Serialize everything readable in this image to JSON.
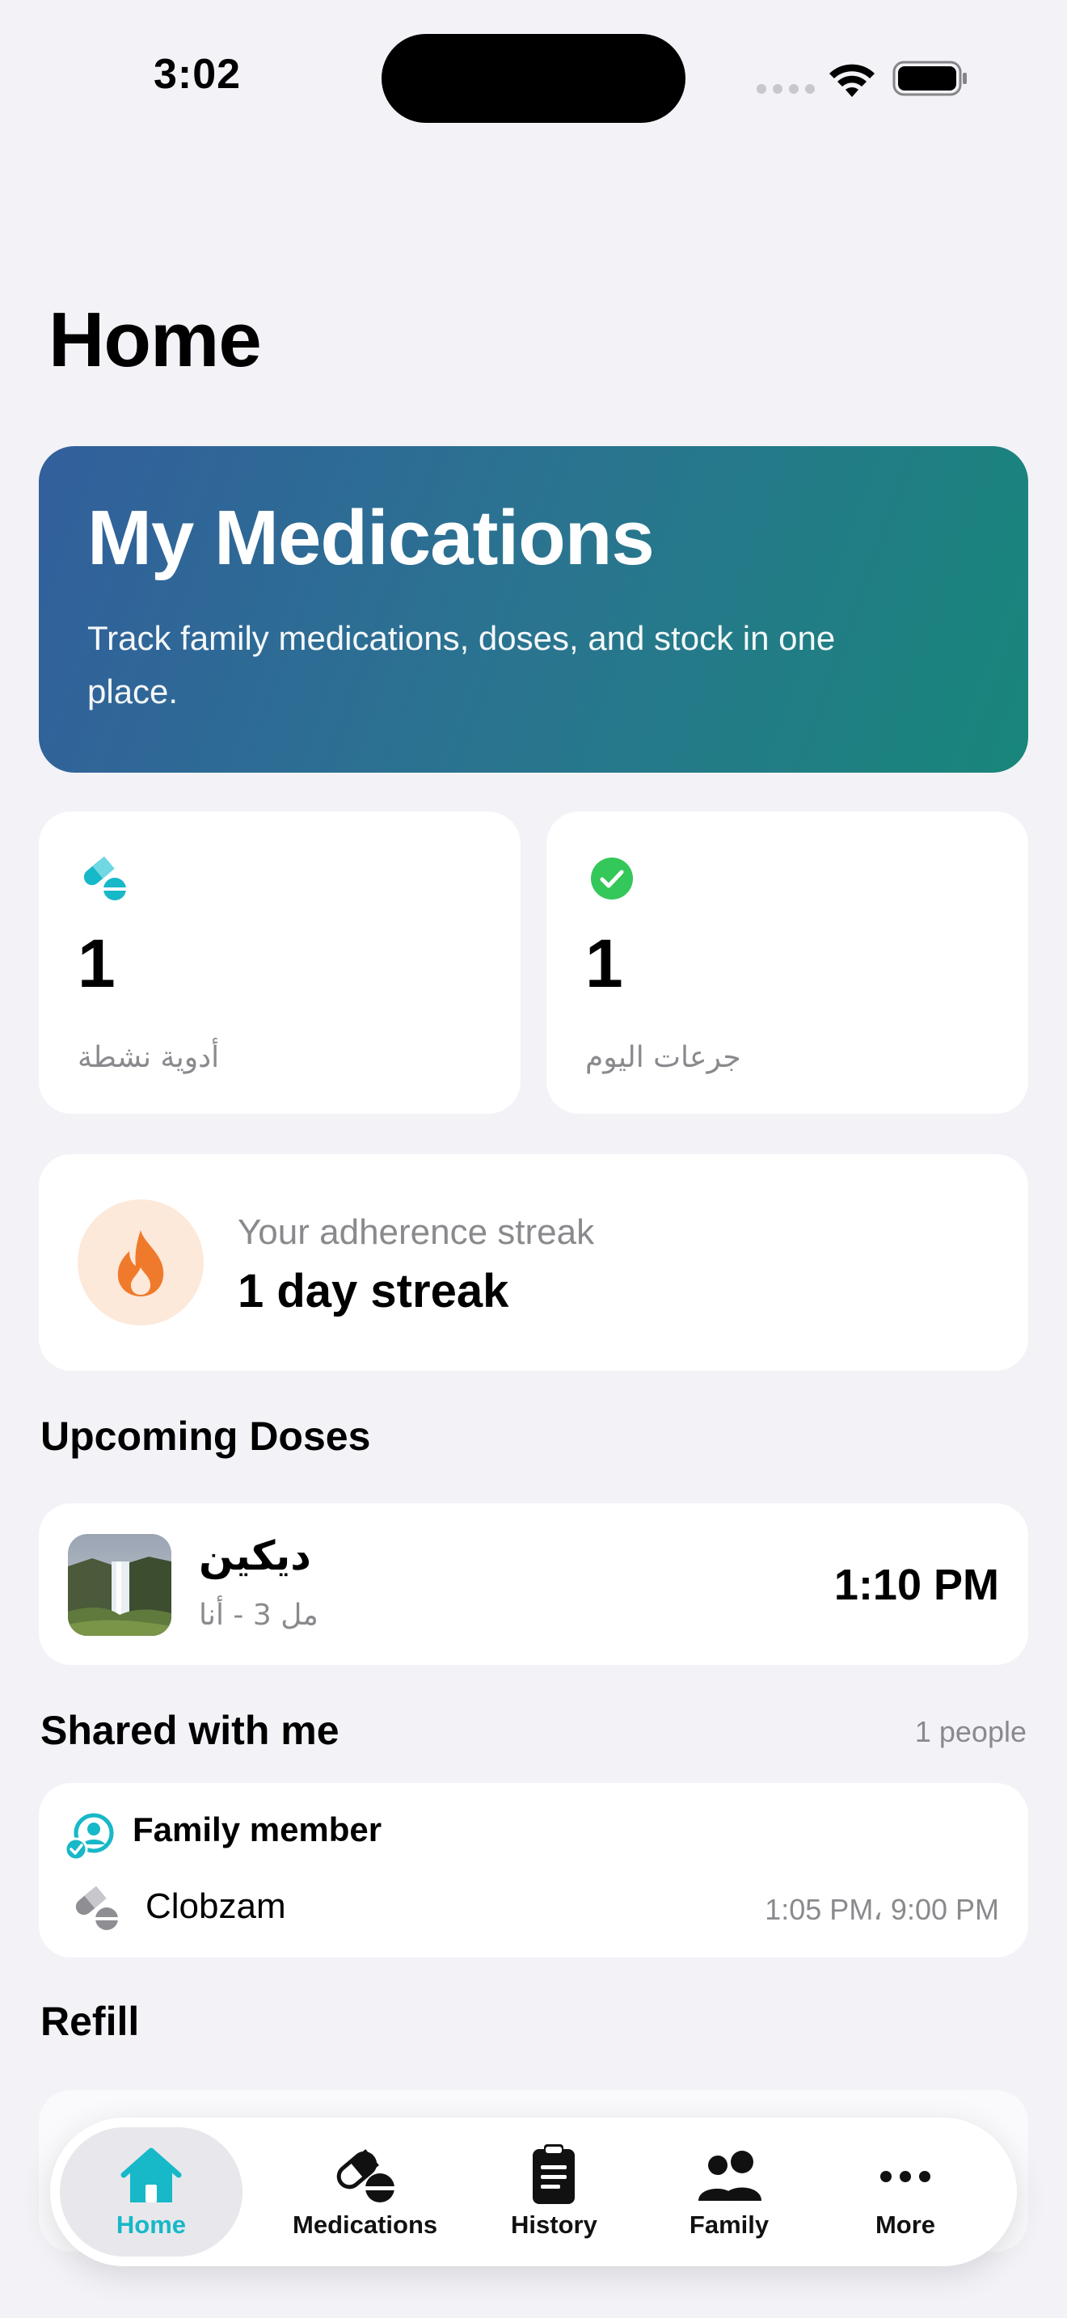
{
  "status_bar": {
    "time": "3:02"
  },
  "page": {
    "title": "Home"
  },
  "hero": {
    "title": "My Medications",
    "subtitle": "Track family medications, doses, and stock in one place."
  },
  "stats": [
    {
      "value": "1",
      "label": "أدوية نشطة",
      "icon": "pills-icon"
    },
    {
      "value": "1",
      "label": "جرعات اليوم",
      "icon": "check-circle-icon"
    }
  ],
  "streak": {
    "label": "Your adherence streak",
    "value": "1 day streak",
    "icon": "flame-icon"
  },
  "upcoming": {
    "heading": "Upcoming Doses",
    "items": [
      {
        "name": "ديكين",
        "detail": "مل 3 - أنا",
        "time": "1:10 PM"
      }
    ]
  },
  "shared": {
    "heading": "Shared with me",
    "count": "1 people",
    "member": "Family member",
    "medication": "Clobzam",
    "times": "1:05 PM، 9:00 PM"
  },
  "refill": {
    "heading": "Refill"
  },
  "tabs": [
    {
      "label": "Home",
      "icon": "home-icon",
      "selected": true
    },
    {
      "label": "Medications",
      "icon": "pills-icon"
    },
    {
      "label": "History",
      "icon": "clipboard-icon"
    },
    {
      "label": "Family",
      "icon": "people-icon"
    },
    {
      "label": "More",
      "icon": "ellipsis-icon"
    }
  ],
  "colors": {
    "accent": "#17b8c8",
    "hero_start": "#325f9c",
    "hero_end": "#18867a",
    "success": "#34c759",
    "flame": "#f07a2b"
  }
}
